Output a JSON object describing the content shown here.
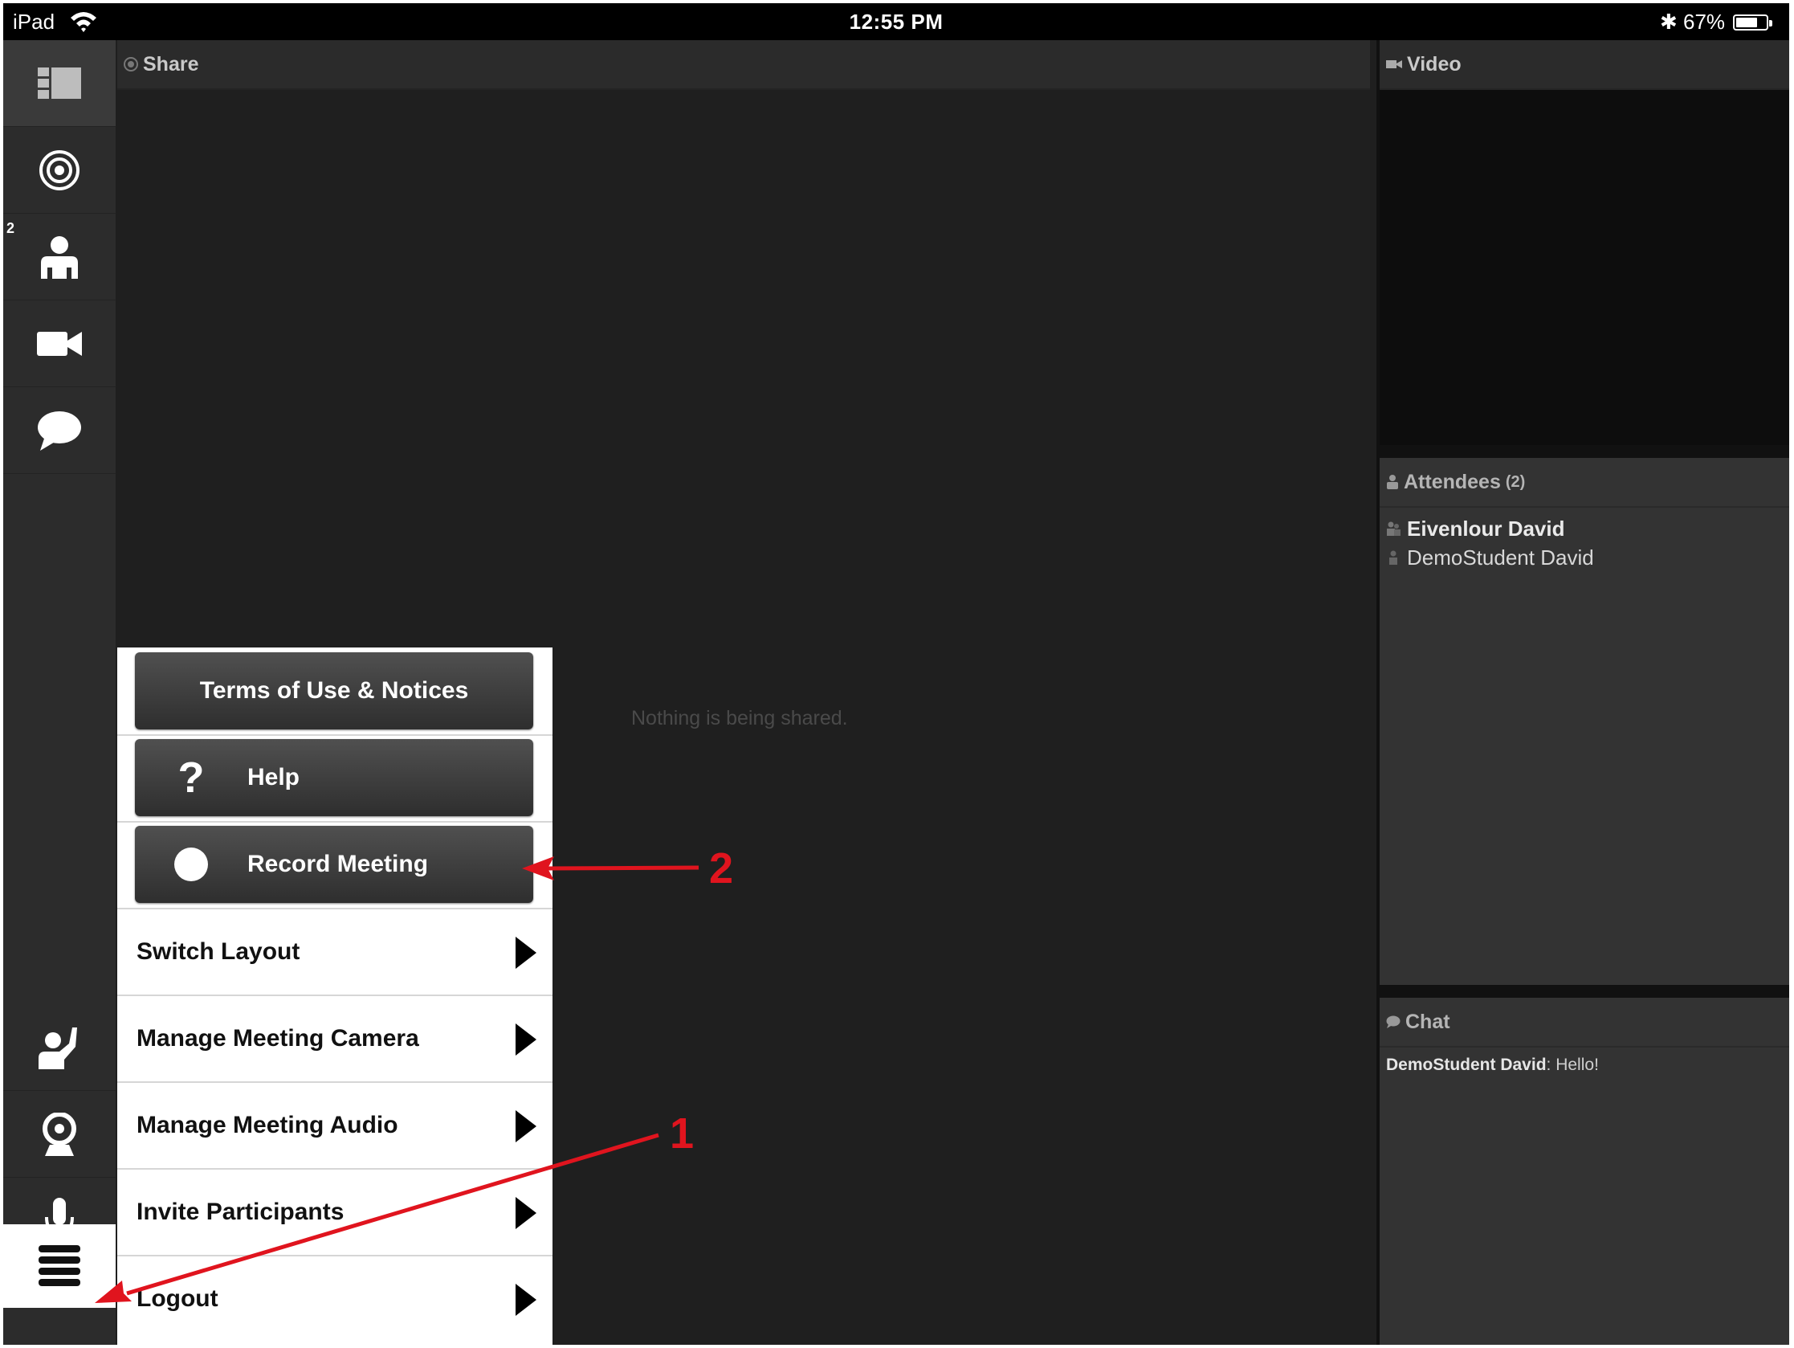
{
  "status_bar": {
    "device": "iPad",
    "time": "12:55 PM",
    "bluetooth": "bluetooth-icon",
    "battery": "67%",
    "battery_level": 0.67
  },
  "sidebar": {
    "items": [
      {
        "icon": "layout-icon",
        "active": true
      },
      {
        "icon": "target-icon"
      },
      {
        "icon": "attendees-icon",
        "badge": "2"
      },
      {
        "icon": "video-camera-icon"
      },
      {
        "icon": "chat-bubble-icon"
      },
      {
        "icon": "raise-hand-icon"
      },
      {
        "icon": "webcam-icon"
      },
      {
        "icon": "microphone-icon"
      },
      {
        "icon": "menu-icon"
      }
    ]
  },
  "share_pane": {
    "title": "Share",
    "empty_message": "Nothing is being shared."
  },
  "video_pane": {
    "title": "Video"
  },
  "attendees_pane": {
    "title": "Attendees",
    "count": "(2)",
    "attendees": [
      {
        "name": "Eivenlour David",
        "role": "host"
      },
      {
        "name": "DemoStudent David",
        "role": "participant"
      }
    ]
  },
  "chat_pane": {
    "title": "Chat",
    "messages": [
      {
        "sender": "DemoStudent David",
        "separator": ":",
        "text": " Hello!"
      }
    ]
  },
  "popup_menu": {
    "terms_label": "Terms of Use & Notices",
    "help_label": "Help",
    "record_label": "Record Meeting",
    "rows": [
      "Switch Layout",
      "Manage Meeting Camera",
      "Manage Meeting Audio",
      "Invite Participants",
      "Logout"
    ]
  },
  "annotations": {
    "label_1": "1",
    "label_2": "2",
    "color": "#e0141e"
  },
  "colors": {
    "background": "#1f1f1f",
    "toolbar": "#2c2c2c",
    "panel": "#333333",
    "menu_button": "#3d3d3d"
  }
}
